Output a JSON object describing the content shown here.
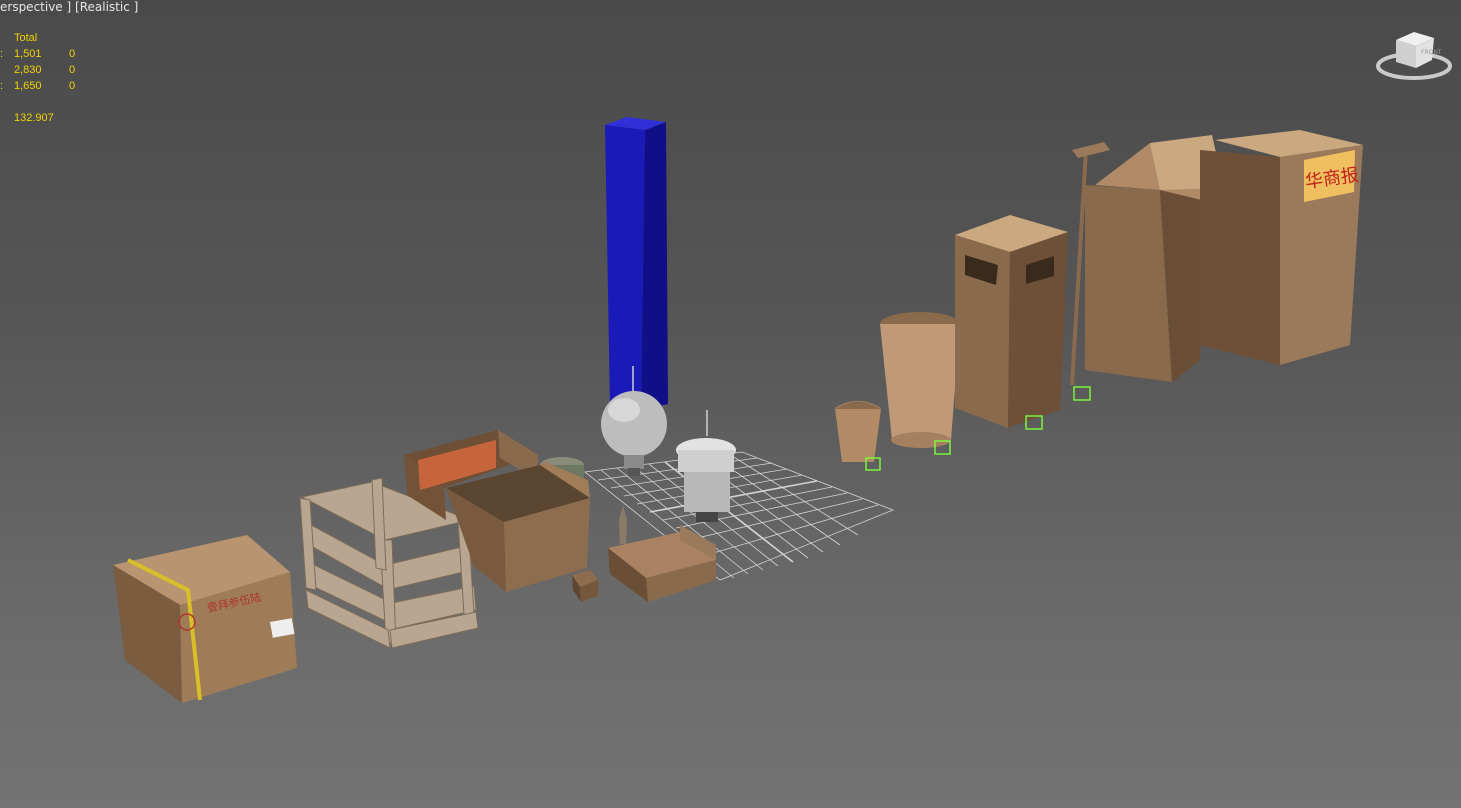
{
  "viewport": {
    "label_prefix": "",
    "view_mode": "erspective ]",
    "shading_mode": "[Realistic ]"
  },
  "statistics": {
    "header": "Total",
    "rows": [
      {
        "prefix": ":",
        "total": "1,501",
        "selected": "0"
      },
      {
        "prefix": "",
        "total": "2,830",
        "selected": "0"
      },
      {
        "prefix": ":",
        "total": "1,650",
        "selected": "0"
      }
    ],
    "fps": "132.907"
  },
  "viewcube": {
    "face_label": "FRONT"
  },
  "colors": {
    "stats_text": "#f0d200",
    "selected_box": "#7bff3a",
    "blue_column": "#1414b4",
    "grid": "#ffffff"
  },
  "box_label_line1": "壹拜参伍陆",
  "kiosk_sign": "华商报"
}
